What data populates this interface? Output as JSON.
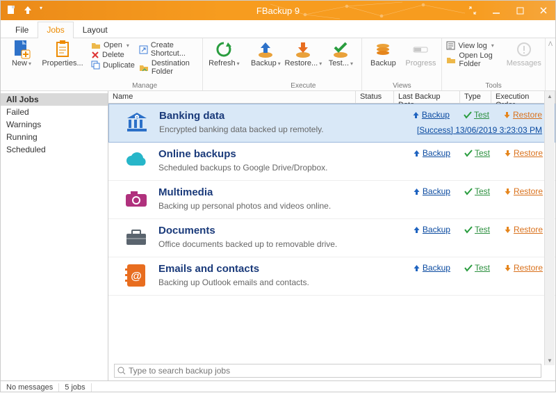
{
  "title": "FBackup 9",
  "menu": {
    "file": "File",
    "jobs": "Jobs",
    "layout": "Layout"
  },
  "ribbon": {
    "new": "New",
    "properties": "Properties...",
    "open": "Open",
    "delete": "Delete",
    "duplicate": "Duplicate",
    "create_shortcut": "Create Shortcut...",
    "destination_folder": "Destination Folder",
    "refresh": "Refresh",
    "backup": "Backup",
    "restore": "Restore...",
    "test": "Test...",
    "backup2": "Backup",
    "progress": "Progress",
    "viewlog": "View log",
    "openlog": "Open Log Folder",
    "messages": "Messages",
    "grp_manage": "Manage",
    "grp_execute": "Execute",
    "grp_views": "Views",
    "grp_tools": "Tools"
  },
  "side": {
    "all": "All Jobs",
    "failed": "Failed",
    "warnings": "Warnings",
    "running": "Running",
    "scheduled": "Scheduled"
  },
  "cols": {
    "name": "Name",
    "status": "Status",
    "last": "Last Backup Date",
    "type": "Type",
    "order": "Execution Order"
  },
  "actions": {
    "backup": "Backup",
    "test": "Test",
    "restore": "Restore"
  },
  "jobs": [
    {
      "title": "Banking data",
      "desc": "Encrypted banking data backed up remotely.",
      "status_label": "[Success]",
      "status_ts": "13/06/2019 3:23:03 PM",
      "selected": true,
      "color": "#2c70c8",
      "icon": "bank"
    },
    {
      "title": "Online backups",
      "desc": "Scheduled backups to Google Drive/Dropbox.",
      "color": "#27b6c9",
      "icon": "cloud"
    },
    {
      "title": "Multimedia",
      "desc": "Backing up personal photos and videos online.",
      "color": "#b0317d",
      "icon": "camera"
    },
    {
      "title": "Documents",
      "desc": "Office documents backed up to removable drive.",
      "color": "#5a646e",
      "icon": "briefcase"
    },
    {
      "title": "Emails and contacts",
      "desc": "Backing up Outlook emails and contacts.",
      "color": "#e86d1f",
      "icon": "contact"
    }
  ],
  "search_placeholder": "Type to search backup jobs",
  "statusbar": {
    "msgs": "No messages",
    "jobs": "5 jobs"
  }
}
